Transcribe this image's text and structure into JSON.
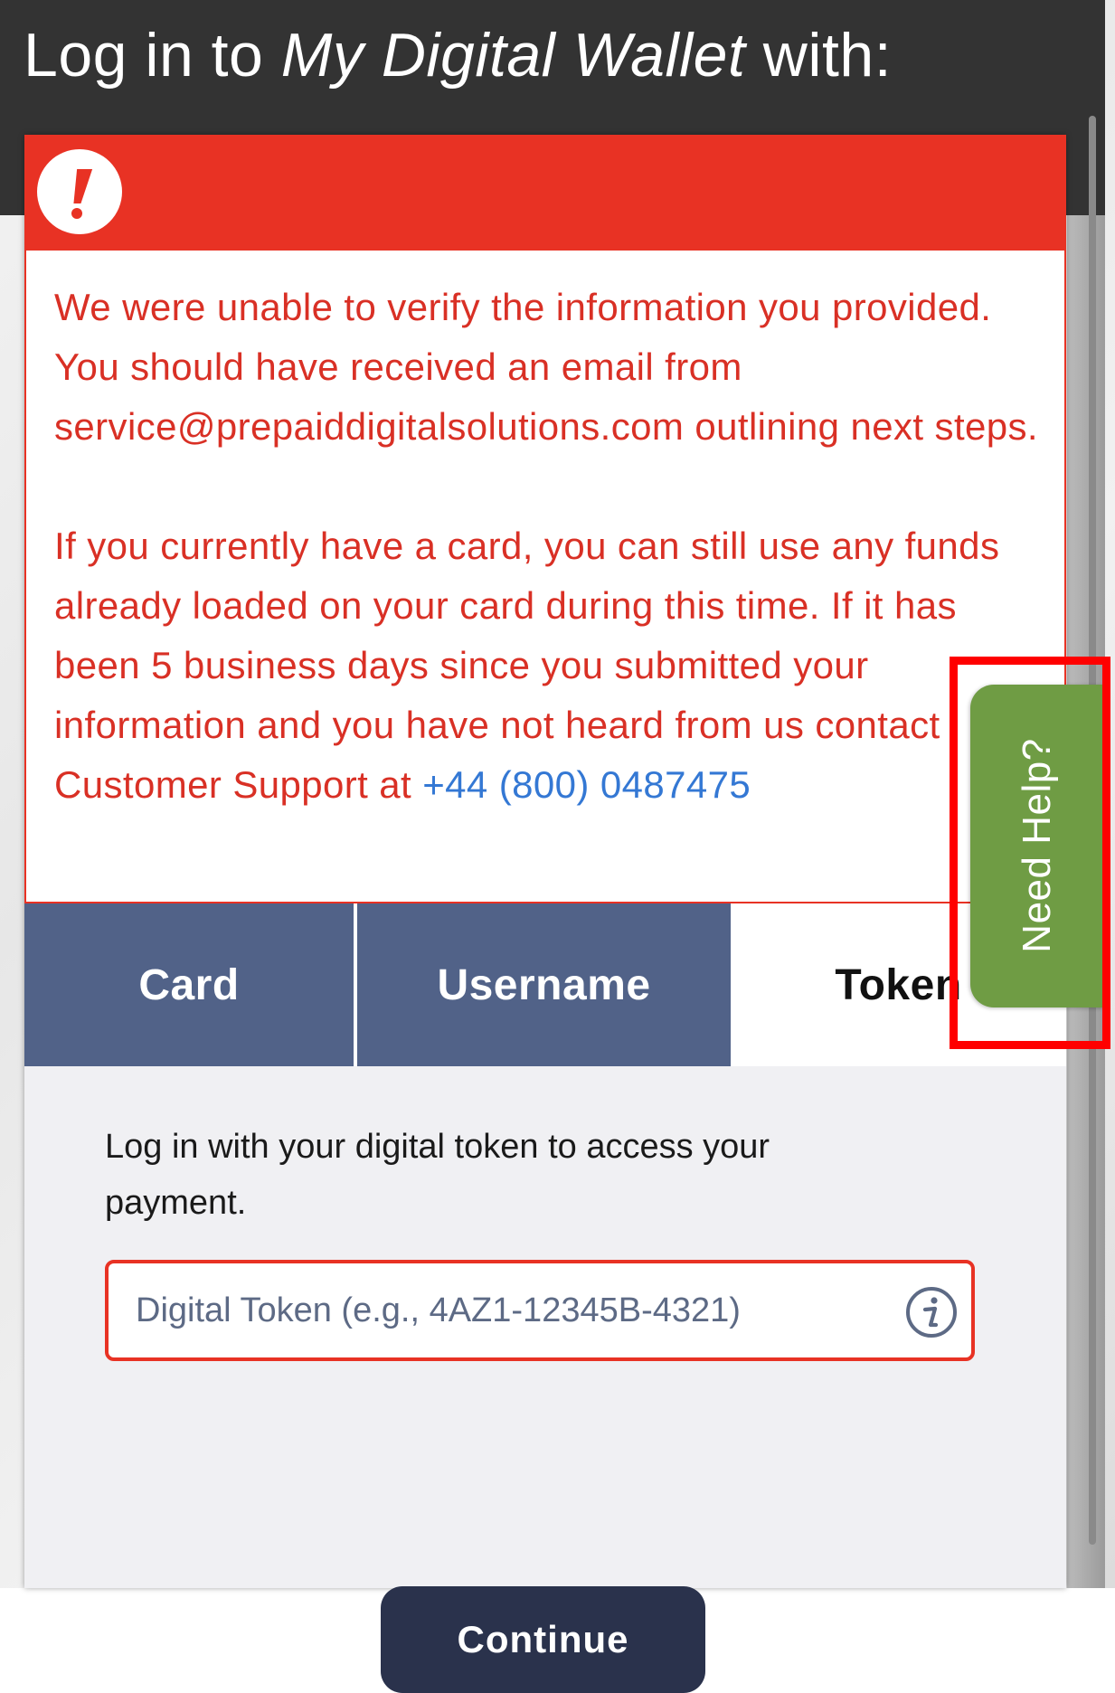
{
  "header": {
    "title_prefix": "Log in to ",
    "title_brand": "My Digital Wallet",
    "title_suffix": " with:"
  },
  "alert": {
    "icon": "exclamation-icon",
    "paragraph_1": "We were unable to verify the information you provided. You should have received an email from service@prepaiddigitalsolutions.com outlining next steps.",
    "paragraph_2_text": "If you currently have a card, you can still use any funds already loaded on your card during this time. If it has been 5 business days since you submitted your information and you have not heard from us contact Customer Support at ",
    "support_phone": "+44 (800) 0487475",
    "colors": {
      "accent": "#e83224",
      "text": "#d93025",
      "link": "#3478d4"
    }
  },
  "tabs": [
    {
      "label": "Card",
      "active": false
    },
    {
      "label": "Username",
      "active": false
    },
    {
      "label": "Token",
      "active": true
    }
  ],
  "token_panel": {
    "intro": "Log in with your digital token to access your payment.",
    "input_placeholder": "Digital Token (e.g., 4AZ1-12345B-4321)",
    "input_value": "",
    "info_icon": "info-icon",
    "continue_label": "Continue"
  },
  "help_tab": {
    "label": "Need Help?",
    "color": "#6f9c44",
    "highlighted": true
  }
}
